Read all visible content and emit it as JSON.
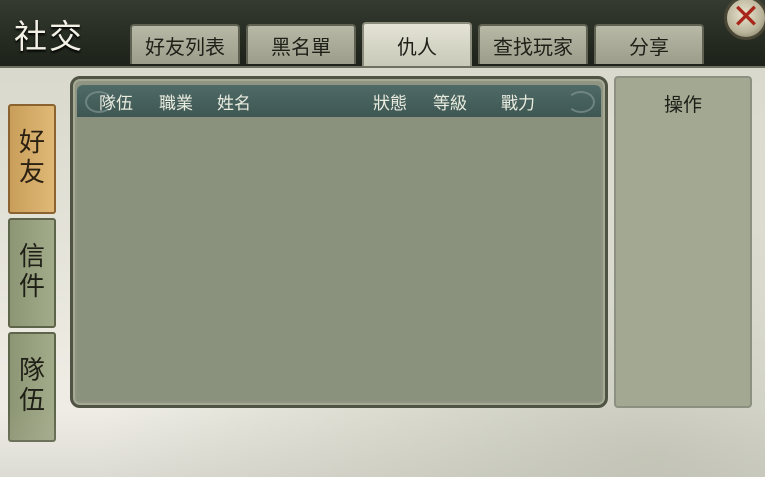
{
  "window": {
    "title": "社交"
  },
  "top_tabs": [
    {
      "label": "好友列表",
      "active": false
    },
    {
      "label": "黑名單",
      "active": false
    },
    {
      "label": "仇人",
      "active": true
    },
    {
      "label": "查找玩家",
      "active": false
    },
    {
      "label": "分享",
      "active": false
    }
  ],
  "side_tabs": [
    {
      "chars": [
        "好",
        "友"
      ],
      "active": true
    },
    {
      "chars": [
        "信",
        "件"
      ],
      "active": false
    },
    {
      "chars": [
        "隊",
        "伍"
      ],
      "active": false
    }
  ],
  "table": {
    "columns": [
      "隊伍",
      "職業",
      "姓名",
      "狀態",
      "等級",
      "戰力"
    ],
    "rows": []
  },
  "ops_panel": {
    "title": "操作"
  },
  "icons": {
    "close": "close-icon"
  },
  "colors": {
    "accent": "#c99e5a",
    "header": "#4f6a67",
    "close_x": "#a8261a"
  }
}
